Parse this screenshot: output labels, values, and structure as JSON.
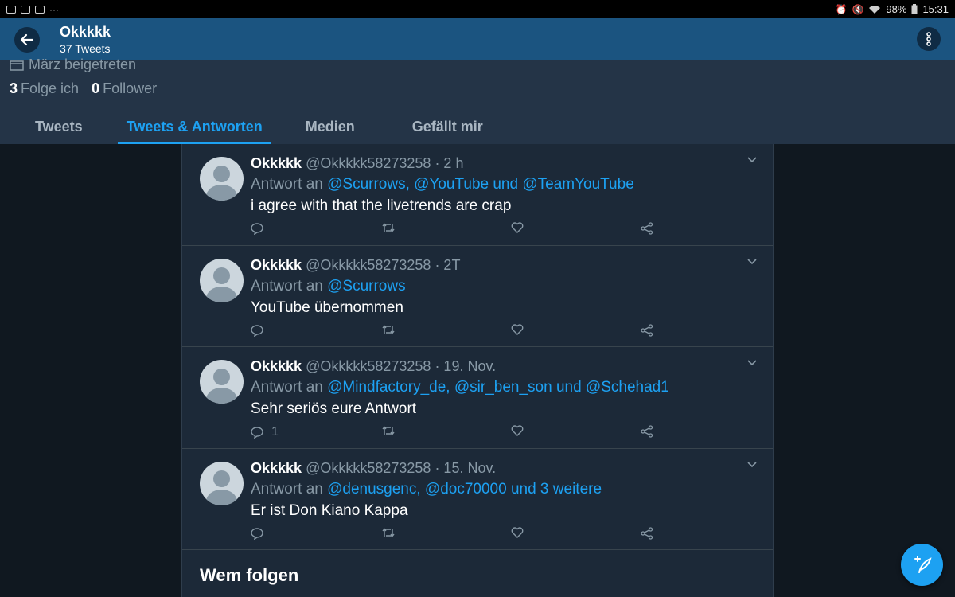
{
  "status_bar": {
    "battery": "98%",
    "time": "15:31",
    "overflow": "···"
  },
  "header": {
    "title": "Okkkkk",
    "subtitle": "37 Tweets"
  },
  "profile": {
    "joined_text": "März beigetreten",
    "following_count": "3",
    "following_label": "Folge ich",
    "followers_count": "0",
    "followers_label": "Follower"
  },
  "tabs": [
    {
      "label": "Tweets",
      "active": false
    },
    {
      "label": "Tweets & Antworten",
      "active": true
    },
    {
      "label": "Medien",
      "active": false
    },
    {
      "label": "Gefällt mir",
      "active": false
    }
  ],
  "tweets": [
    {
      "name": "Okkkkk",
      "handle_time": "@Okkkkk58273258 · 2 h",
      "reply_prefix": "Antwort an",
      "reply_to": "@Scurrows, @YouTube und @TeamYouTube",
      "text": "i agree with that the livetrends are crap",
      "reply_count": ""
    },
    {
      "name": "Okkkkk",
      "handle_time": "@Okkkkk58273258 · 2T",
      "reply_prefix": "Antwort an",
      "reply_to": "@Scurrows",
      "text": "YouTube übernommen",
      "reply_count": ""
    },
    {
      "name": "Okkkkk",
      "handle_time": "@Okkkkk58273258 · 19. Nov.",
      "reply_prefix": "Antwort an",
      "reply_to": "@Mindfactory_de, @sir_ben_son und @Schehad1",
      "text": "Sehr seriös eure Antwort",
      "reply_count": "1"
    },
    {
      "name": "Okkkkk",
      "handle_time": "@Okkkkk58273258 · 15. Nov.",
      "reply_prefix": "Antwort an",
      "reply_to": "@denusgenc, @doc70000 und 3 weitere",
      "text": "Er ist Don Kiano Kappa",
      "reply_count": ""
    }
  ],
  "who_to_follow": {
    "title": "Wem folgen"
  },
  "colors": {
    "accent": "#1da1f2",
    "header_bg": "#1b5480",
    "panel_bg": "#1c2938"
  }
}
